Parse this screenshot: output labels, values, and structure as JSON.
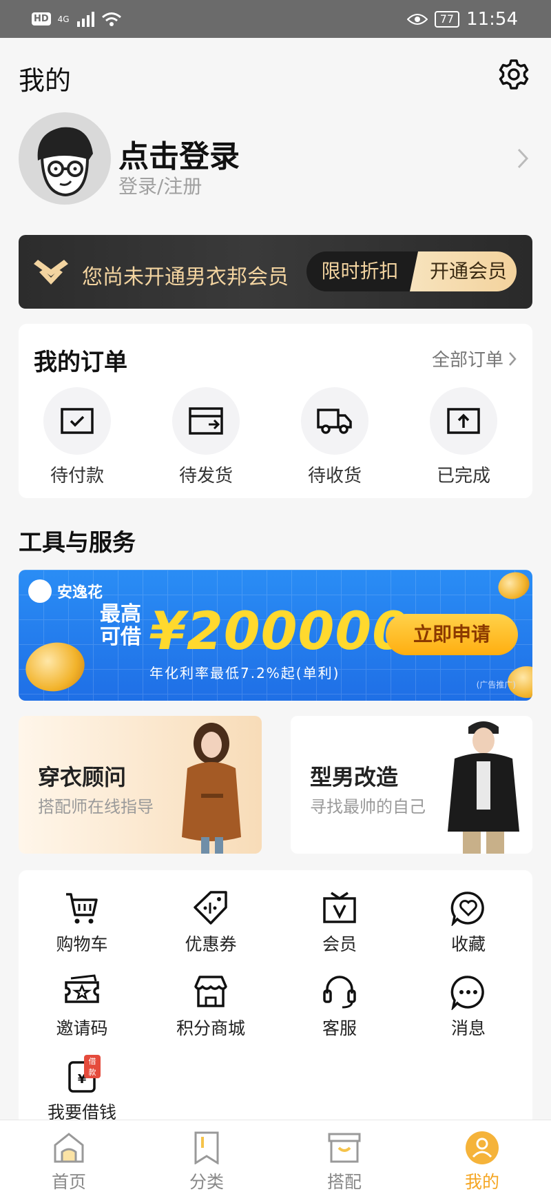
{
  "status_bar": {
    "hd": "HD",
    "network": "4G",
    "battery": "77",
    "time": "11:54"
  },
  "header": {
    "title": "我的",
    "settings_icon": "gear-icon"
  },
  "profile": {
    "title": "点击登录",
    "subtitle": "登录/注册"
  },
  "member": {
    "text": "您尚未开通男衣邦会员",
    "discount_label": "限时折扣",
    "open_label": "开通会员",
    "accent": "#f3d4a0"
  },
  "orders": {
    "title": "我的订单",
    "all_label": "全部订单",
    "items": [
      {
        "label": "待付款",
        "icon": "pending-payment-icon"
      },
      {
        "label": "待发货",
        "icon": "pending-shipment-icon"
      },
      {
        "label": "待收货",
        "icon": "delivery-truck-icon"
      },
      {
        "label": "已完成",
        "icon": "completed-upload-icon"
      }
    ]
  },
  "tools": {
    "title": "工具与服务"
  },
  "ad": {
    "brand": "安逸花",
    "lead": "最高可借",
    "amount": "¥200000",
    "subtitle": "年化利率最低7.2%起(单利)",
    "cta": "立即申请",
    "tag": "(广告推广)"
  },
  "promos": [
    {
      "title": "穿衣顾问",
      "subtitle": "搭配师在线指导"
    },
    {
      "title": "型男改造",
      "subtitle": "寻找最帅的自己"
    }
  ],
  "services": [
    {
      "label": "购物车",
      "icon": "cart-icon"
    },
    {
      "label": "优惠券",
      "icon": "coupon-tag-icon"
    },
    {
      "label": "会员",
      "icon": "vip-icon"
    },
    {
      "label": "收藏",
      "icon": "favorite-heart-icon"
    },
    {
      "label": "邀请码",
      "icon": "invite-ticket-icon"
    },
    {
      "label": "积分商城",
      "icon": "points-store-icon"
    },
    {
      "label": "客服",
      "icon": "headset-icon"
    },
    {
      "label": "消息",
      "icon": "message-bubble-icon"
    },
    {
      "label": "我要借钱",
      "icon": "loan-icon",
      "badge": "借款"
    }
  ],
  "bottom_nav": [
    {
      "label": "首页",
      "icon": "home-icon"
    },
    {
      "label": "分类",
      "icon": "category-bookmark-icon"
    },
    {
      "label": "搭配",
      "icon": "outfit-box-icon"
    },
    {
      "label": "我的",
      "icon": "profile-icon",
      "active": true
    }
  ],
  "colors": {
    "active_tab": "#f5a623",
    "ad_blue": "#1f6fe6",
    "ad_yellow": "#ffd92e"
  }
}
